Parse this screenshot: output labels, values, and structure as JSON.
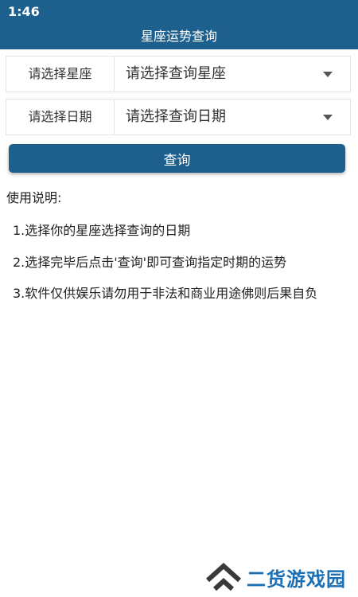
{
  "status_bar": {
    "time": "1:46"
  },
  "title_bar": {
    "title": "星座运势查询"
  },
  "zodiac_selector": {
    "label": "请选择星座",
    "value": "请选择查询星座"
  },
  "date_selector": {
    "label": "请选择日期",
    "value": "请选择查询日期"
  },
  "query_button": {
    "label": "查询"
  },
  "instructions": {
    "title": "使用说明:",
    "items": [
      "1.选择你的星座选择查询的日期",
      "2.选择完毕后点击'查询'即可查询指定时期的运势",
      "3.软件仅供娱乐请勿用于非法和商业用途佛则后果自负"
    ]
  },
  "watermark": {
    "text": "二货游戏园",
    "color": "#1a6fb5"
  },
  "colors": {
    "primary": "#1d5f8d",
    "border": "#e4e4e4"
  }
}
